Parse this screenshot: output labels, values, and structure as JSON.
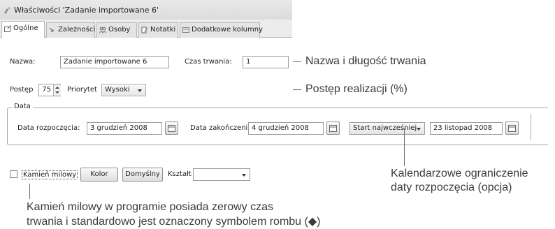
{
  "window": {
    "title": "Właściwości 'Zadanie importowane 6'"
  },
  "tabs": [
    {
      "label": "Ogólne",
      "icon": "general-icon",
      "active": true
    },
    {
      "label": "Zależności",
      "icon": "dependency-icon",
      "active": false
    },
    {
      "label": "Osoby",
      "icon": "people-icon",
      "active": false
    },
    {
      "label": "Notatki",
      "icon": "notes-icon",
      "active": false
    },
    {
      "label": "Dodatkowe kolumny",
      "icon": "columns-icon",
      "active": false
    }
  ],
  "general": {
    "name_label": "Nazwa:",
    "name_value": "Zadanie importowane 6",
    "duration_label": "Czas trwania:",
    "duration_value": "1",
    "progress_label": "Postęp",
    "progress_value": "75",
    "priority_label": "Priorytet",
    "priority_value": "Wysoki"
  },
  "date_group": {
    "legend": "Data",
    "start_label": "Data rozpoczęcia:",
    "start_value": "3 grudzień 2008",
    "end_label": "Data zakończenia:",
    "end_value": "4 grudzień 2008",
    "constraint_value": "Start najwcześniej",
    "constraint_date": "23 listopad 2008"
  },
  "milestone": {
    "checkbox_label": "Kamień milowy",
    "checked": false,
    "color_button": "Kolor",
    "default_button": "Domyślny",
    "shape_label": "Kształt",
    "shape_value": ""
  },
  "annotations": {
    "name_duration": "Nazwa i długość trwania",
    "progress": "Postęp realizacji (%)",
    "constraint_line1": "Kalendarzowe ograniczenie",
    "constraint_line2": "daty rozpoczęcia (opcja)",
    "milestone_line1": "Kamień milowy w programie posiada zerowy czas",
    "milestone_line2": "trwania i standardowo jest oznaczony symbolem rombu (◆)"
  },
  "colors": {
    "titlebar": "#dcdcdc",
    "tabbar": "#ececec",
    "annotation_text": "#3b3b3b"
  }
}
